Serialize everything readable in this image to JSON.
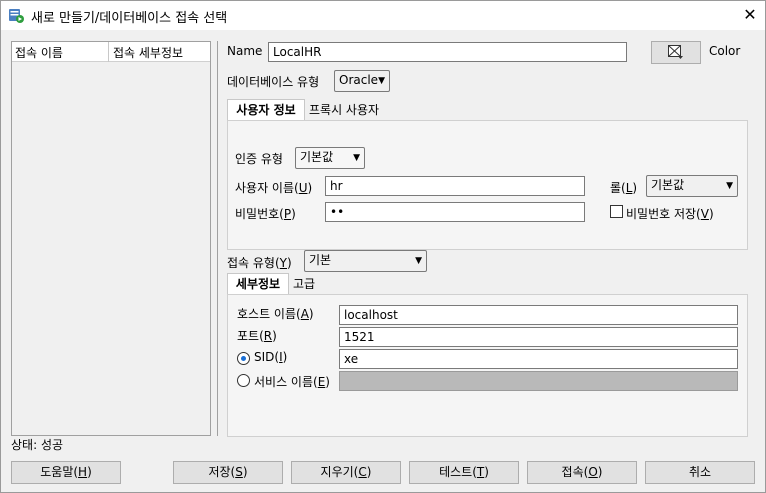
{
  "window": {
    "title": "새로 만들기/데이터베이스 접속 선택",
    "close_glyph": "✕"
  },
  "connection_list": {
    "columns": [
      "접속 이름",
      "접속 세부정보"
    ]
  },
  "form": {
    "name_label": "Name",
    "name_value": "LocalHR",
    "color_label": "Color",
    "db_type_label": "데이터베이스 유형",
    "db_type_value": "Oracle",
    "tabs": [
      "사용자 정보",
      "프록시 사용자"
    ],
    "auth_type_label": "인증 유형",
    "auth_type_value": "기본값",
    "username_label": "사용자 이름(",
    "username_key": "U",
    "username_value": "hr",
    "role_label": "롤(",
    "role_key": "L",
    "role_value": "기본값",
    "password_label": "비밀번호(",
    "password_key": "P",
    "password_value": "••",
    "save_password_label": "비밀번호 저장(",
    "save_password_key": "V",
    "conn_type_label": "접속 유형(",
    "conn_type_key": "Y",
    "conn_type_value": "기본",
    "detail_tabs": [
      "세부정보",
      "고급"
    ],
    "host_label": "호스트 이름(",
    "host_key": "A",
    "host_value": "localhost",
    "port_label": "포트(",
    "port_key": "R",
    "port_value": "1521",
    "sid_label": "SID(",
    "sid_key": "I",
    "sid_value": "xe",
    "service_label": "서비스 이름(",
    "service_key": "E",
    "service_value": ""
  },
  "status": {
    "text": "상태: 성공"
  },
  "buttons": {
    "help": {
      "label": "도움말(",
      "key": "H"
    },
    "save": {
      "label": "저장(",
      "key": "S"
    },
    "clear": {
      "label": "지우기(",
      "key": "C"
    },
    "test": {
      "label": "테스트(",
      "key": "T"
    },
    "connect": {
      "label": "접속(",
      "key": "O"
    },
    "cancel": {
      "label": "취소"
    }
  },
  "colors": {
    "accent": "#1a6fd6",
    "panel": "#f5f5f5",
    "window_bg": "#f0f0f0"
  }
}
